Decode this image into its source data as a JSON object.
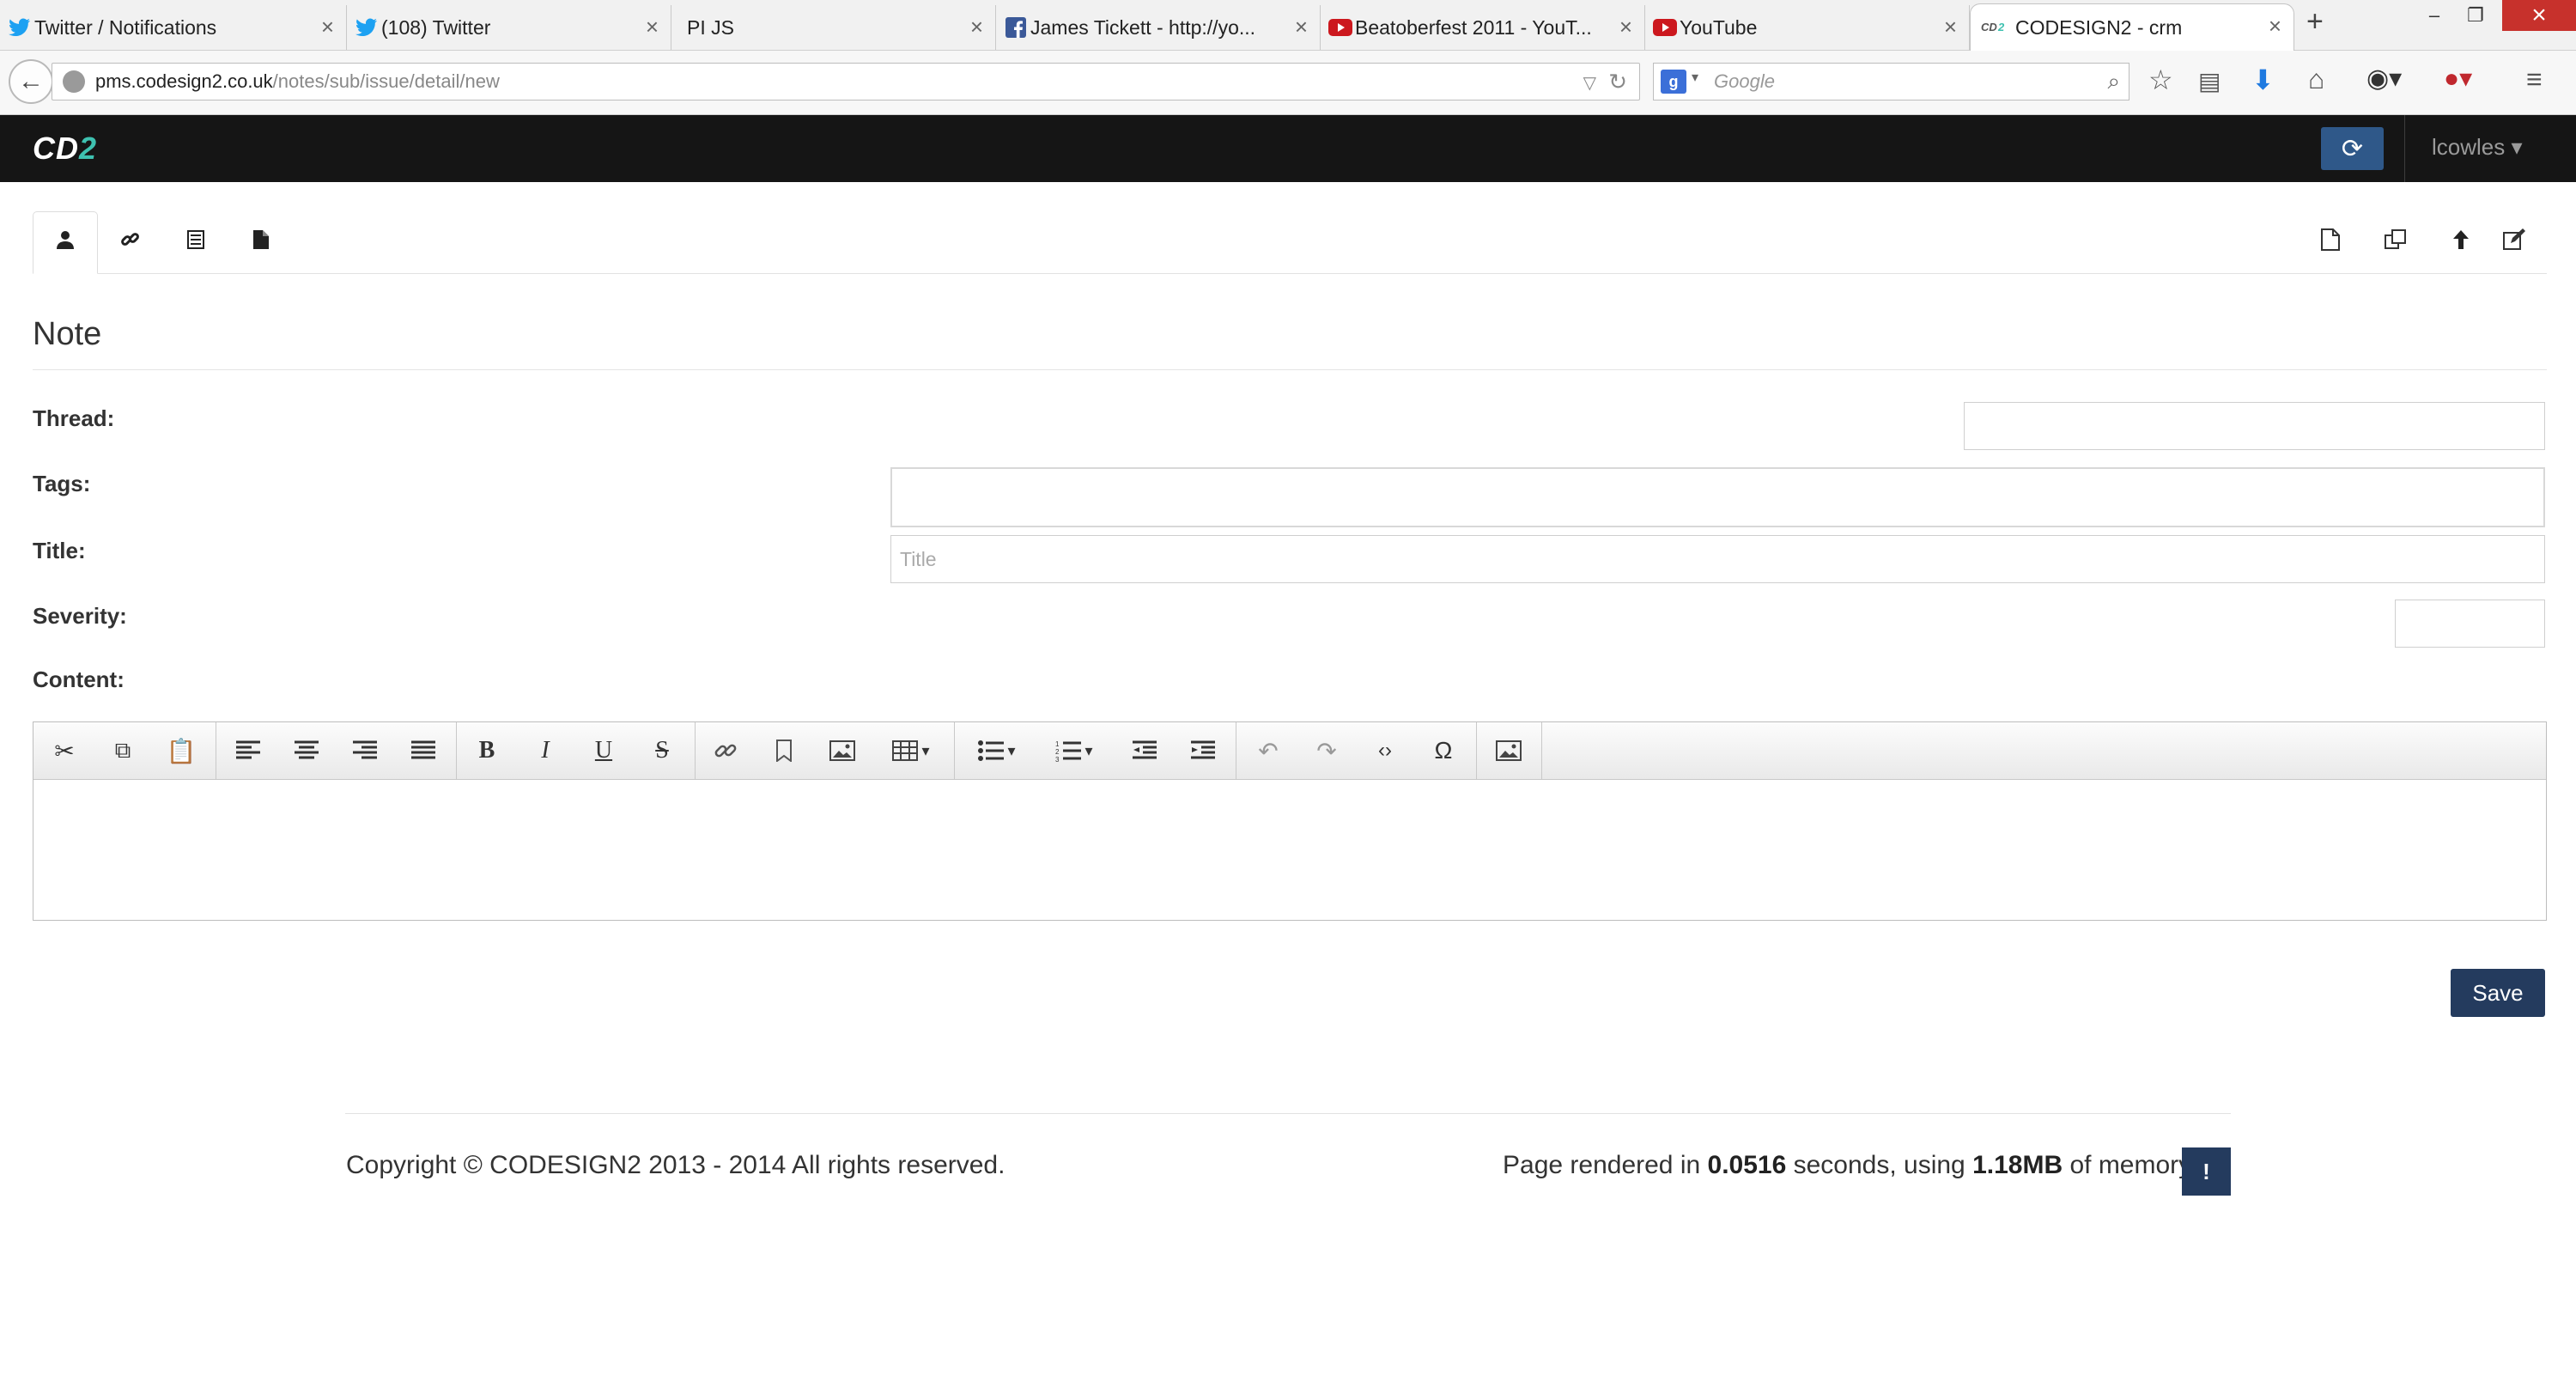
{
  "browser": {
    "tabs": [
      {
        "label": "Twitter / Notifications",
        "icon": "twitter-icon",
        "color": "#1da1f2"
      },
      {
        "label": "(108) Twitter",
        "icon": "twitter-icon",
        "color": "#1da1f2"
      },
      {
        "label": "PI JS",
        "icon": "",
        "color": ""
      },
      {
        "label": "James Tickett - http://yo...",
        "icon": "facebook-icon",
        "color": "#3b5998"
      },
      {
        "label": "Beatoberfest 2011 - YouT...",
        "icon": "youtube-icon",
        "color": "#cc181e"
      },
      {
        "label": "YouTube",
        "icon": "youtube-icon",
        "color": "#cc181e"
      },
      {
        "label": "CODESIGN2 - crm",
        "icon": "cd2-icon",
        "color": "#3ec1b0"
      }
    ],
    "url_host": "pms.codesign2.co.uk",
    "url_path": "/notes/sub/issue/detail/new",
    "search_placeholder": "Google"
  },
  "app": {
    "brand_prefix": "CD",
    "brand_suffix": "2",
    "user": "lcowles",
    "accent": "#243b5e"
  },
  "page": {
    "title": "Note"
  },
  "form": {
    "thread_label": "Thread:",
    "tags_label": "Tags:",
    "title_label": "Title:",
    "title_placeholder": "Title",
    "severity_label": "Severity:",
    "content_label": "Content:",
    "save_label": "Save"
  },
  "footer": {
    "copyright": "Copyright © CODESIGN2 2013 - 2014 All rights reserved.",
    "render_prefix": "Page rendered in ",
    "render_time": "0.0516",
    "render_mid": " seconds, using ",
    "render_mem": "1.18MB",
    "render_suffix": " of memory.",
    "info_label": "!"
  }
}
